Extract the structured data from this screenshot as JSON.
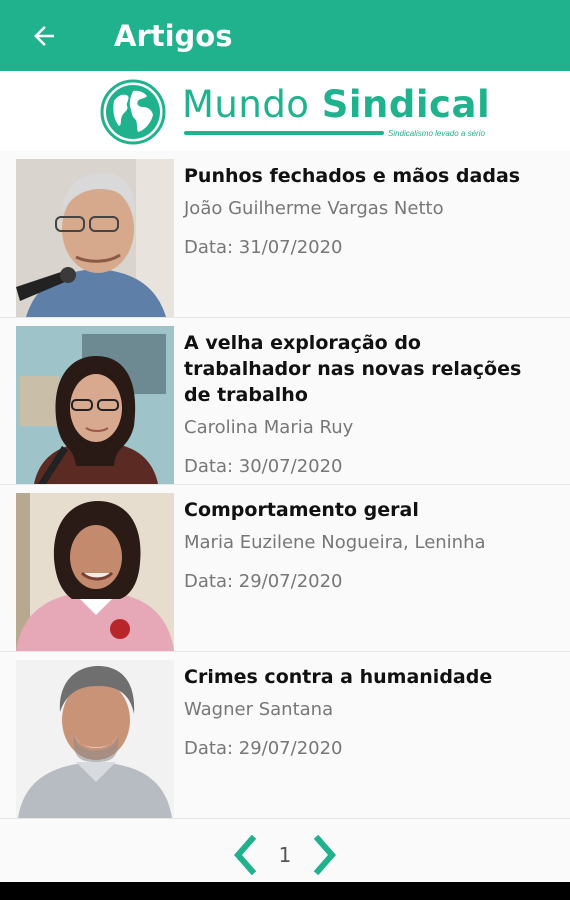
{
  "appbar": {
    "title": "Artigos",
    "back_icon": "arrow-left-icon",
    "color": "#1fb28d"
  },
  "logo": {
    "word1": "Mundo",
    "word2": "Sindical",
    "tagline": "Sindicalismo levado a sério",
    "icon": "globe-icon"
  },
  "articles": [
    {
      "title": "Punhos fechados e mãos dadas",
      "author": "João Guilherme Vargas Netto",
      "date": "Data: 31/07/2020"
    },
    {
      "title": "A velha exploração do trabalhador nas novas relações de trabalho",
      "author": "Carolina Maria Ruy",
      "date": "Data: 30/07/2020"
    },
    {
      "title": "Comportamento geral",
      "author": "Maria Euzilene Nogueira, Leninha",
      "date": "Data: 29/07/2020"
    },
    {
      "title": "Crimes contra a humanidade",
      "author": "Wagner Santana",
      "date": "Data: 29/07/2020"
    }
  ],
  "pager": {
    "current_page": "1",
    "prev_icon": "chevron-left-icon",
    "next_icon": "chevron-right-icon"
  }
}
